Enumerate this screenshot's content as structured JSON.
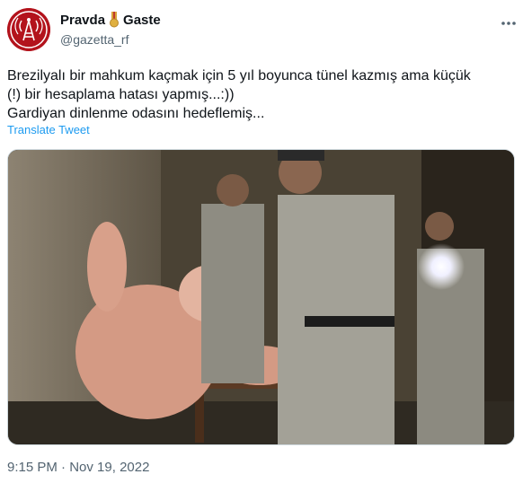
{
  "author": {
    "display_name_part1": "Pravda",
    "display_name_part2": "Gaste",
    "handle": "@gazetta_rf"
  },
  "tweet": {
    "text": "Brezilyalı bir mahkum kaçmak için 5 yıl boyunca tünel kazmış ama küçük\n(!) bir hesaplama hatası yapmış...:))\nGardiyan dinlenme odasını hedeflemiş...",
    "translate_label": "Translate Tweet",
    "time": "9:15 PM",
    "separator": "·",
    "date": "Nov 19, 2022"
  },
  "icons": {
    "avatar": "radio-tower-logo-icon",
    "medal": "medal-ribbon-icon",
    "more": "more-dots-icon"
  },
  "colors": {
    "avatar_bg": "#b3131c",
    "link": "#1d9bf0",
    "secondary_text": "#536471"
  }
}
